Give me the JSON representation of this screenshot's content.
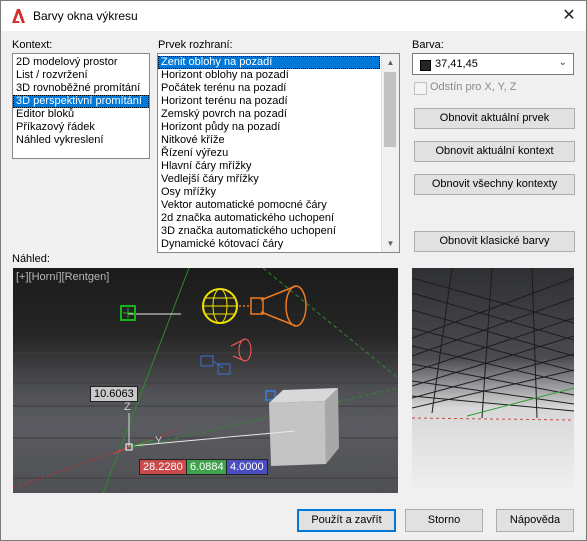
{
  "window": {
    "title": "Barvy okna výkresu",
    "close_glyph": "✕"
  },
  "context": {
    "label": "Kontext:",
    "items": [
      "2D modelový prostor",
      "List / rozvržení",
      "3D rovnoběžné promítání",
      "3D perspektivní promítání",
      "Editor bloků",
      "Příkazový řádek",
      "Náhled vykreslení"
    ],
    "selected_index": 3
  },
  "interface_element": {
    "label": "Prvek rozhraní:",
    "items": [
      "Zenit oblohy na pozadí",
      "Horizont oblohy na pozadí",
      "Počátek terénu na pozadí",
      "Horizont terénu na pozadí",
      "Zemský povrch na pozadí",
      "Horizont půdy na pozadí",
      "Nitkové kříže",
      "Řízení výřezu",
      "Hlavní čáry mřížky",
      "Vedlejší čáry mřížky",
      "Osy mřížky",
      "Vektor automatické pomocné čáry",
      "2d značka automatického uchopení",
      "3D značka automatického uchopení",
      "Dynamické kótovací čáry"
    ],
    "selected_index": 0
  },
  "color": {
    "label": "Barva:",
    "value": "37,41,45",
    "swatch": "#252929",
    "tint_checkbox_label": "Odstín pro X, Y, Z",
    "tint_checked": false
  },
  "buttons": {
    "restore_current_element": "Obnovit aktuální prvek",
    "restore_current_context": "Obnovit aktuální kontext",
    "restore_all_contexts": "Obnovit všechny kontexty",
    "restore_classic_colors": "Obnovit klasické barvy",
    "apply_close": "Použít a zavřít",
    "cancel": "Storno",
    "help": "Nápověda"
  },
  "preview": {
    "label": "Náhled:",
    "viewport_label": "[+][Horní][Rentgen]",
    "dimension_value": "10.6063",
    "coord_x": "28.2280",
    "coord_y": "6.0884",
    "coord_z": "4.0000",
    "axis_y": "Y",
    "axis_z": "Z"
  },
  "colors": {
    "accent": "#0078d7",
    "coord_x_bg": "#c84a4a",
    "coord_y_bg": "#3fa34d",
    "coord_z_bg": "#4a4ec0",
    "sun_yellow": "#f2e200",
    "light_orange": "#f07a1e"
  }
}
